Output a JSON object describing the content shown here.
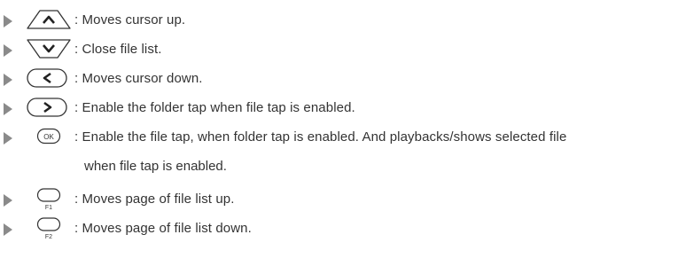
{
  "items": [
    {
      "icon": "arrow-up-key-icon",
      "text": ": Moves cursor up."
    },
    {
      "icon": "arrow-down-key-icon",
      "text": ": Close file list."
    },
    {
      "icon": "arrow-left-key-icon",
      "text": ": Moves cursor down."
    },
    {
      "icon": "arrow-right-key-icon",
      "text": ": Enable the folder tap when file tap is enabled."
    },
    {
      "icon": "ok-key-icon",
      "key_label": "OK",
      "text": ": Enable the file tap, when folder tap is enabled. And playbacks/shows selected file",
      "text_cont": "when file tap is enabled."
    },
    {
      "icon": "f1-key-icon",
      "key_label": "F1",
      "text": ": Moves page of file list up."
    },
    {
      "icon": "f2-key-icon",
      "key_label": "F2",
      "text": ": Moves page of file list down."
    }
  ]
}
